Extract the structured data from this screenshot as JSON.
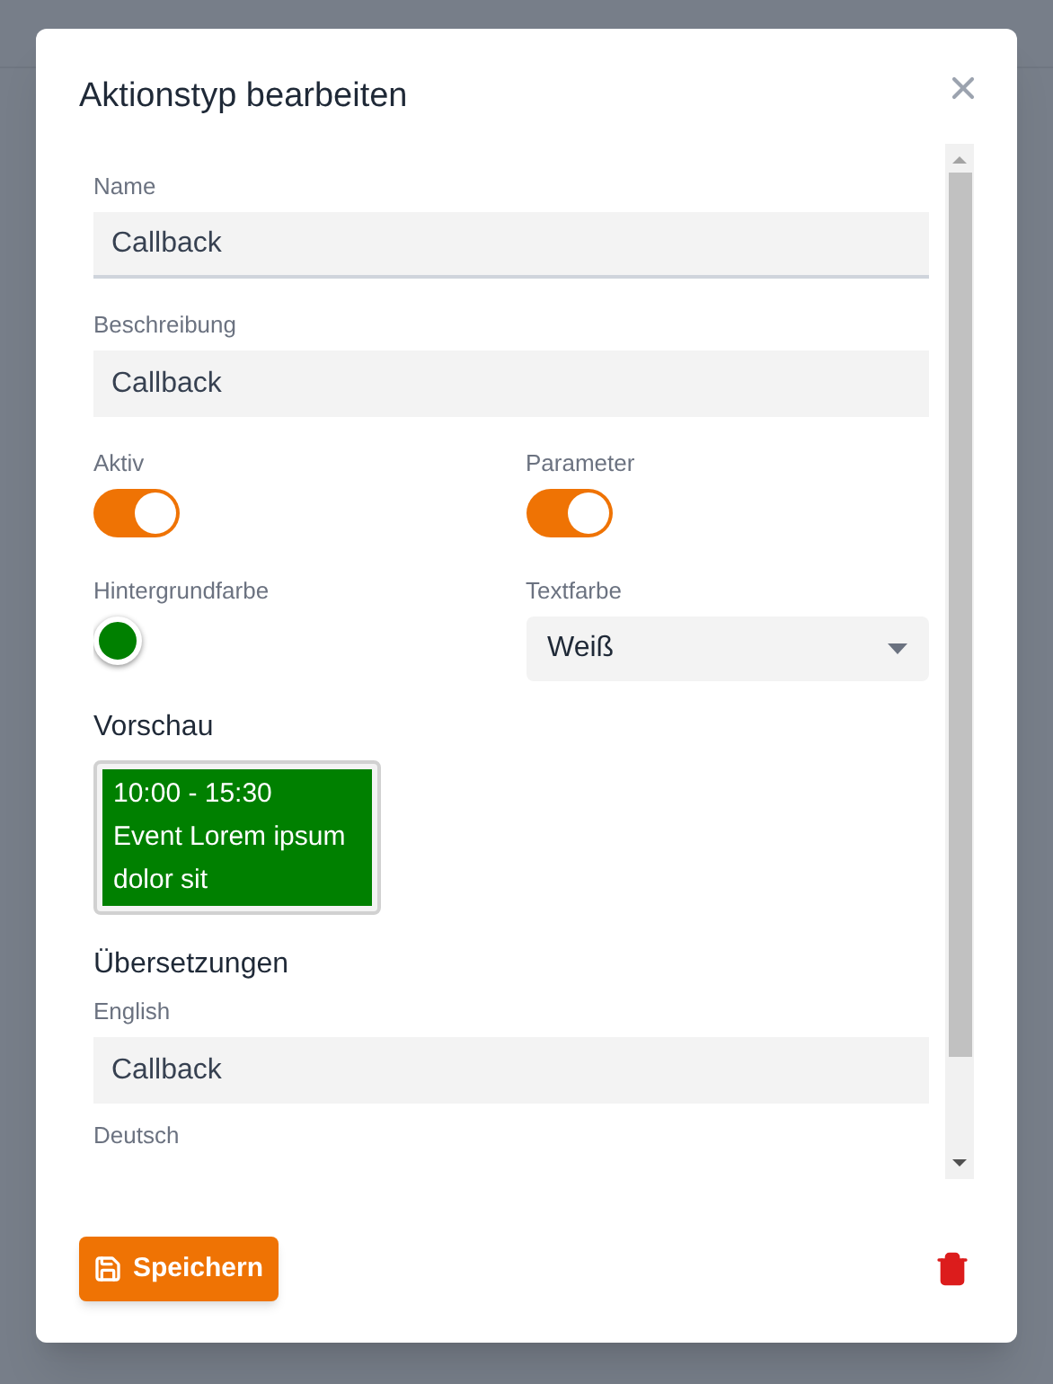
{
  "dialog": {
    "title": "Aktionstyp bearbeiten"
  },
  "name_field": {
    "label": "Name",
    "value": "Callback",
    "focused": true
  },
  "description_field": {
    "label": "Beschreibung",
    "value": "Callback"
  },
  "toggles": [
    {
      "label": "Aktiv",
      "on": true
    },
    {
      "label": "Parameter",
      "on": true
    }
  ],
  "background_color": {
    "label": "Hintergrundfarbe",
    "color": "#008000"
  },
  "text_color": {
    "label": "Textfarbe",
    "value": "Weiß"
  },
  "preview": {
    "heading": "Vorschau",
    "lines": [
      "10:00 - 15:30",
      "Event Lorem ipsum dolor sit"
    ]
  },
  "translations": {
    "heading": "Übersetzungen",
    "items": [
      {
        "label": "English",
        "value": "Callback"
      },
      {
        "label": "Deutsch"
      }
    ]
  },
  "save_button": {
    "label": "Speichern"
  }
}
